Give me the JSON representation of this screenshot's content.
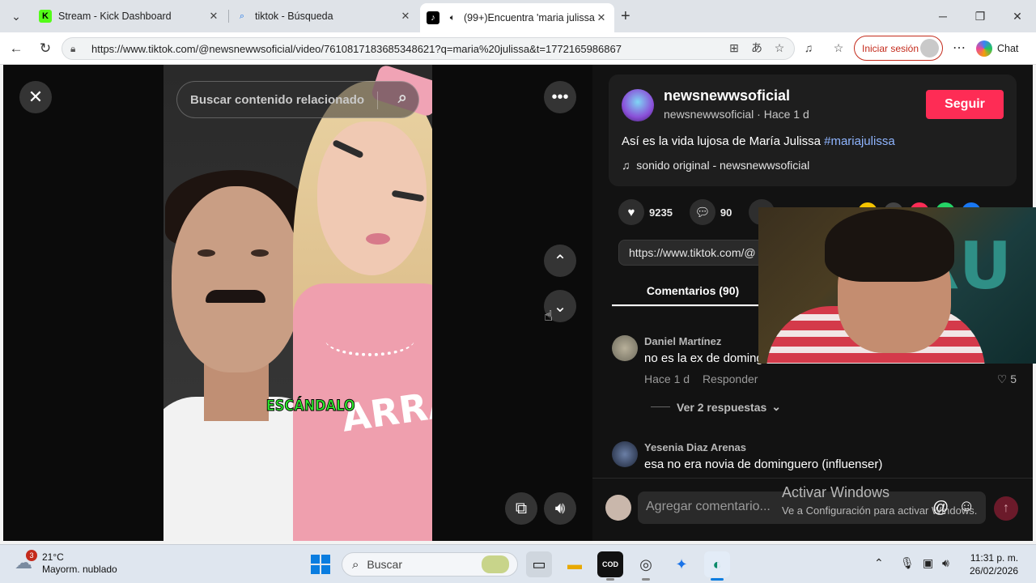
{
  "browser": {
    "tabs": [
      {
        "title": "Stream - Kick Dashboard",
        "favicon": "kick-icon",
        "color": "#53fc18"
      },
      {
        "title": "tiktok - Búsqueda",
        "favicon": "search-icon",
        "color": "#1a73e8"
      },
      {
        "title": "(99+)Encuentra 'maria julissa'",
        "favicon": "tiktok-icon",
        "color": "#000000",
        "active": true
      }
    ],
    "new_tab": "+",
    "url": "https://www.tiktok.com/@newsnewwsoficial/video/7610817183685348621?q=maria%20julissa&t=1772165986867",
    "login_label": "Iniciar sesión",
    "chat_label": "Chat"
  },
  "video": {
    "search_placeholder": "Buscar contenido relacionado",
    "overlay_caption": "ESCÁNDALO",
    "jersey_text": "ARRA"
  },
  "post": {
    "author_handle": "newsnewwsoficial",
    "author_sub": "newsnewwsoficial · Hace 1 d",
    "follow_label": "Seguir",
    "description": "Así es la vida lujosa de María Julissa",
    "hashtag": "#mariajulissa",
    "sound": "sonido original - newsnewwsoficial",
    "likes": "9235",
    "comments_count": "90",
    "link": "https://www.tiktok.com/@",
    "comments_tab": "Comentarios (90)",
    "share_colors": [
      "#f5c400",
      "#444444",
      "#fe2c55",
      "#25d366",
      "#1877f2"
    ]
  },
  "comments": [
    {
      "user": "Daniel Martínez",
      "text": "no es la ex de dominguero",
      "time": "Hace 1 d",
      "reply": "Responder",
      "likes": "5",
      "more": "Ver 2 respuestas"
    },
    {
      "user": "Yesenia Diaz Arenas",
      "text": "esa no era novia de dominguero (influenser)"
    }
  ],
  "comment_input": {
    "placeholder": "Agregar comentario...",
    "at": "@"
  },
  "watermark": {
    "title": "Activar Windows",
    "subtitle": "Ve a Configuración para activar Windows."
  },
  "webcam": {
    "letters": "RU"
  },
  "taskbar": {
    "weather_badge": "3",
    "temperature": "21°C",
    "condition": "Mayorm. nublado",
    "search_label": "Buscar",
    "time": "11:31 p. m.",
    "date": "26/02/2026"
  }
}
